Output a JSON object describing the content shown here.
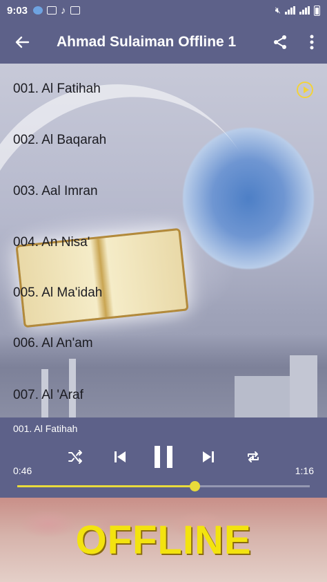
{
  "status_bar": {
    "time": "9:03",
    "icons": [
      "app-icon",
      "image-icon",
      "music-icon",
      "storage-icon"
    ],
    "right_icons": [
      "mute-icon",
      "signal-icon",
      "signal-icon",
      "battery-icon"
    ]
  },
  "app_bar": {
    "title": "Ahmad Sulaiman Offline 1",
    "back_icon": "arrow-left-icon",
    "share_icon": "share-icon",
    "more_icon": "more-vertical-icon"
  },
  "tracks": [
    {
      "label": "001. Al Fatihah",
      "playing": true
    },
    {
      "label": "002. Al Baqarah"
    },
    {
      "label": "003. Aal Imran"
    },
    {
      "label": "004. An Nisa'"
    },
    {
      "label": "005. Al Ma'idah"
    },
    {
      "label": "006. Al An'am"
    },
    {
      "label": "007. Al 'Araf"
    }
  ],
  "player": {
    "now_playing": "001. Al Fatihah",
    "current_time": "0:46",
    "total_time": "1:16",
    "progress": 0.605,
    "controls": [
      "shuffle-icon",
      "skip-previous-icon",
      "pause-icon",
      "skip-next-icon",
      "repeat-icon"
    ]
  },
  "banner": {
    "text": "OFFLINE"
  },
  "colors": {
    "bar": "#5d6189",
    "accent": "#e9dc3b",
    "banner_text": "#f3e30f"
  }
}
